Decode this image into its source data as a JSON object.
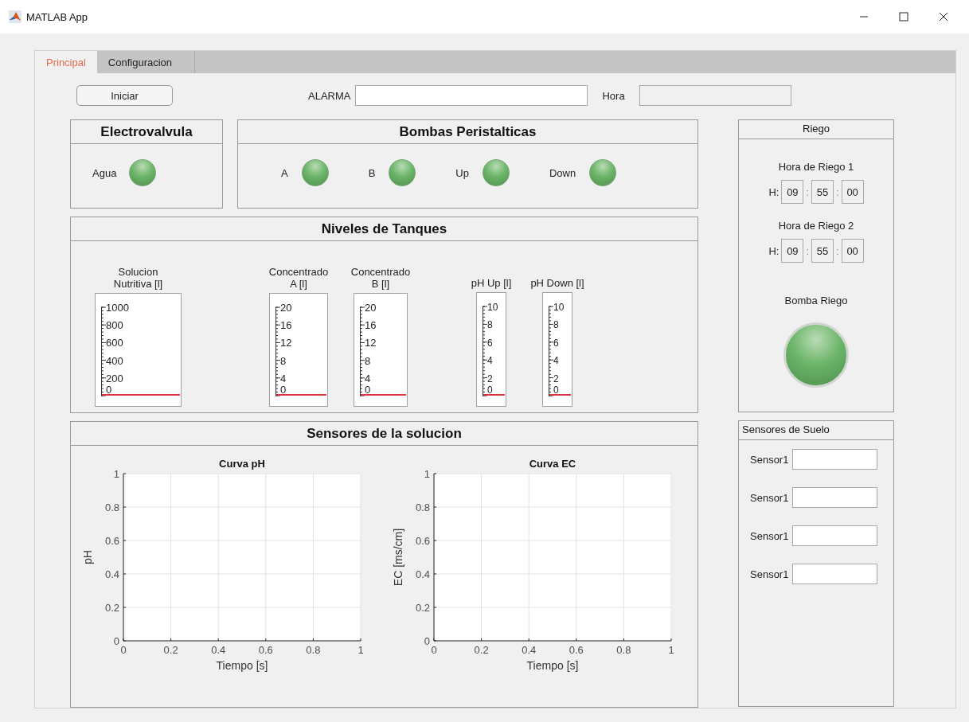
{
  "window": {
    "title": "MATLAB App"
  },
  "tabs": [
    {
      "label": "Principal",
      "selected": true
    },
    {
      "label": "Configuracion",
      "selected": false
    }
  ],
  "toolbar": {
    "start_button": "Iniciar",
    "alarm": {
      "label": "ALARMA",
      "disabled": false
    },
    "clock": {
      "label": "Hora",
      "disabled": true
    }
  },
  "electrovalvula": {
    "title": "Electrovalvula",
    "lamps": [
      {
        "label": "Agua",
        "on": true
      }
    ]
  },
  "bombas": {
    "title": "Bombas Peristalticas",
    "lamps": [
      {
        "label": "A",
        "on": true
      },
      {
        "label": "B",
        "on": true
      },
      {
        "label": "Up",
        "on": true
      },
      {
        "label": "Down",
        "on": true
      }
    ]
  },
  "niveles": {
    "title": "Niveles de Tanques",
    "gauges": [
      {
        "label": "Solucion Nutritiva [l]",
        "ticks": [
          "1000",
          "800",
          "600",
          "400",
          "200",
          "0"
        ],
        "level": 0
      },
      {
        "label": "Concentrado A [l]",
        "ticks": [
          "20",
          "16",
          "12",
          "8",
          "4",
          "0"
        ],
        "level": 0
      },
      {
        "label": "Concentrado B [l]",
        "ticks": [
          "20",
          "16",
          "12",
          "8",
          "4",
          "0"
        ],
        "level": 0
      },
      {
        "label": "pH Up [l]",
        "ticks": [
          "10",
          "8",
          "6",
          "4",
          "2",
          "0"
        ],
        "level": 0
      },
      {
        "label": "pH Down [l]",
        "ticks": [
          "10",
          "8",
          "6",
          "4",
          "2",
          "0"
        ],
        "level": 0
      }
    ]
  },
  "sensores": {
    "title": "Sensores de la solucion",
    "charts": [
      {
        "chart_data": {
          "type": "line",
          "title": "Curva pH",
          "xlabel": "Tiempo [s]",
          "ylabel": "pH",
          "xlim": [
            0,
            1
          ],
          "ylim": [
            0,
            1
          ],
          "xticks": [
            0,
            0.2,
            0.4,
            0.6,
            0.8,
            1
          ],
          "yticks": [
            0,
            0.2,
            0.4,
            0.6,
            0.8,
            1
          ],
          "grid": true
        }
      },
      {
        "chart_data": {
          "type": "line",
          "title": "Curva EC",
          "xlabel": "Tiempo [s]",
          "ylabel": "EC [ms/cm]",
          "xlim": [
            0,
            1
          ],
          "ylim": [
            0,
            1
          ],
          "xticks": [
            0,
            0.2,
            0.4,
            0.6,
            0.8,
            1
          ],
          "yticks": [
            0,
            0.2,
            0.4,
            0.6,
            0.8,
            1
          ],
          "grid": true
        }
      }
    ]
  },
  "riego": {
    "title": "Riego",
    "schedules": [
      {
        "label": "Hora de Riego 1",
        "prefix": "H:",
        "hour": "09",
        "separator_1": ":",
        "minute": "55",
        "separator_2": ":",
        "second": "00"
      },
      {
        "label": "Hora de Riego 2",
        "prefix": "H:",
        "hour": "09",
        "separator_1": ":",
        "minute": "55",
        "separator_2": ":",
        "second": "00"
      }
    ],
    "pump": {
      "label": "Bomba Riego",
      "on": true
    }
  },
  "suelo": {
    "title": "Sensores de Suelo",
    "sensors": [
      {
        "label": "Sensor1"
      },
      {
        "label": "Sensor1"
      },
      {
        "label": "Sensor1"
      },
      {
        "label": "Sensor1"
      }
    ]
  }
}
